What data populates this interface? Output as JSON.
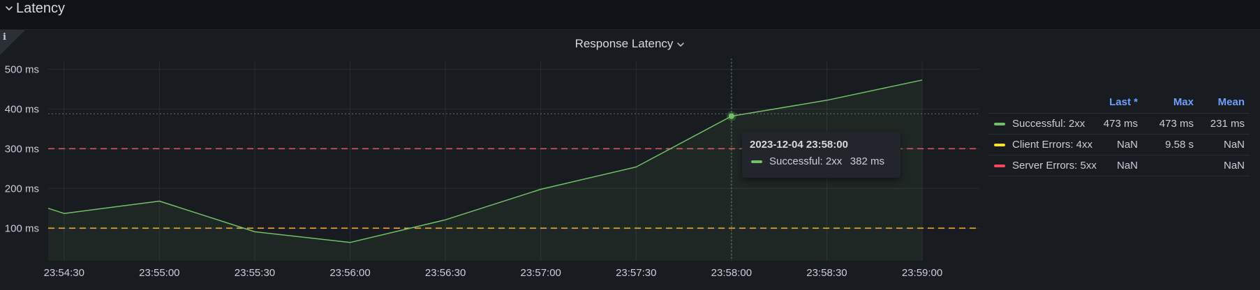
{
  "row": {
    "title": "Latency"
  },
  "panel": {
    "title": "Response Latency",
    "info_icon": "info-icon"
  },
  "colors": {
    "successful": "#73bf69",
    "client": "#fade2a",
    "server": "#f2495c",
    "threshold_red": "#e0505e",
    "threshold_orange": "#f8a63a",
    "legend_header": "#6e9fff"
  },
  "legend": {
    "headers": {
      "last": "Last *",
      "max": "Max",
      "mean": "Mean"
    },
    "rows": [
      {
        "name": "Successful: 2xx",
        "last": "473 ms",
        "max": "473 ms",
        "mean": "231 ms",
        "color": "#73bf69"
      },
      {
        "name": "Client Errors: 4xx",
        "last": "NaN",
        "max": "9.58 s",
        "mean": "NaN",
        "color": "#fade2a"
      },
      {
        "name": "Server Errors: 5xx",
        "last": "NaN",
        "max": "",
        "mean": "NaN",
        "color": "#f2495c"
      }
    ]
  },
  "tooltip": {
    "time": "2023-12-04 23:58:00",
    "series": "Successful: 2xx",
    "value": "382 ms"
  },
  "chart_data": {
    "type": "line",
    "xlabel": "",
    "ylabel": "",
    "y_ticks": [
      "500 ms",
      "400 ms",
      "300 ms",
      "200 ms",
      "100 ms"
    ],
    "x_ticks": [
      "23:54:30",
      "23:55:00",
      "23:55:30",
      "23:56:00",
      "23:56:30",
      "23:57:00",
      "23:57:30",
      "23:58:00",
      "23:58:30",
      "23:59:00"
    ],
    "ylim": [
      18,
      520
    ],
    "xlim": [
      "23:54:25",
      "23:59:18"
    ],
    "thresholds": [
      {
        "value": 300,
        "color": "#e0505e",
        "style": "dashed"
      },
      {
        "value": 100,
        "color": "#f8a63a",
        "style": "dashed"
      }
    ],
    "hover_y": 388,
    "series": [
      {
        "name": "Successful: 2xx",
        "color": "#73bf69",
        "points": [
          [
            "23:54:25",
            150
          ],
          [
            "23:54:30",
            137
          ],
          [
            "23:55:00",
            168
          ],
          [
            "23:55:30",
            91
          ],
          [
            "23:56:00",
            64
          ],
          [
            "23:56:30",
            121
          ],
          [
            "23:57:00",
            198
          ],
          [
            "23:57:30",
            254
          ],
          [
            "23:58:00",
            382
          ],
          [
            "23:58:30",
            422
          ],
          [
            "23:59:00",
            473
          ]
        ]
      }
    ]
  }
}
